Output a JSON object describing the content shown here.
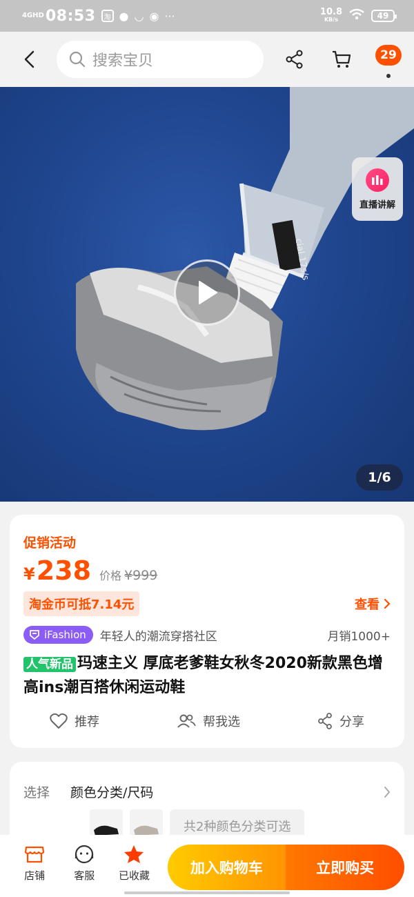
{
  "status_bar": {
    "network": "4GHD",
    "time": "08:53",
    "app_badge": "淘",
    "speed_value": "10.8",
    "speed_unit": "KB/s",
    "battery": "49"
  },
  "header": {
    "search_placeholder": "搜索宝贝",
    "message_count": "29"
  },
  "gallery": {
    "live_label": "直播讲解",
    "page_indicator": "1/6"
  },
  "price_card": {
    "promo_label": "促销活动",
    "currency_symbol": "¥",
    "price": "238",
    "original_label": "价格",
    "original_price": "¥999",
    "coin_offer": "淘金币可抵7.14元",
    "view_link": "查看",
    "brand_badge": "iFashion",
    "brand_slogan": "年轻人的潮流穿搭社区",
    "monthly_sales": "月销1000+",
    "new_tag": "人气新品",
    "title": "玛速主义 厚底老爹鞋女秋冬2020新款黑色增高ins潮百搭休闲运动鞋",
    "actions": {
      "recommend": "推荐",
      "help_choose": "帮我选",
      "share": "分享"
    }
  },
  "select_card": {
    "label": "选择",
    "value": "颜色分类/尺码",
    "variant_note": "共2种颜色分类可选"
  },
  "bottom_bar": {
    "store": "店铺",
    "service": "客服",
    "favorited": "已收藏",
    "add_to_cart": "加入购物车",
    "buy_now": "立即购买"
  },
  "colors": {
    "accent": "#ff5000",
    "cart_button": "#ffa500",
    "buy_button": "#ff5000",
    "new_tag": "#22c36a",
    "brand_badge": "#8b5cf6"
  }
}
